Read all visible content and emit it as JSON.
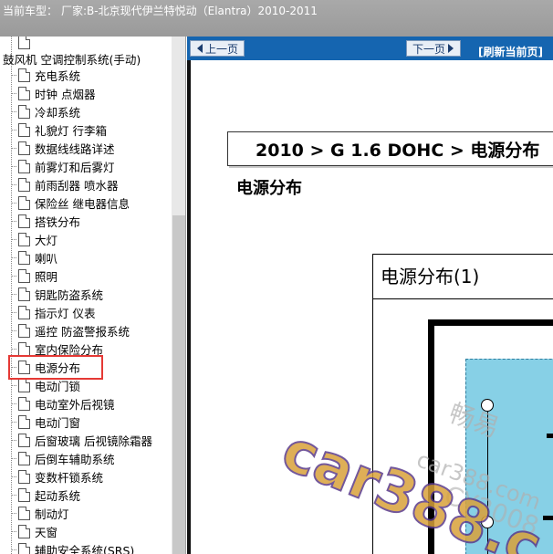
{
  "header": {
    "label": "当前车型：",
    "vehicle": "厂家:B-北京现代伊兰特悦动（Elantra）2010-2011"
  },
  "sidebar": {
    "folder_label": "鼓风机 空调控制系统(手动)",
    "items": [
      {
        "label": "充电系统"
      },
      {
        "label": "时钟 点烟器"
      },
      {
        "label": "冷却系统"
      },
      {
        "label": "礼貌灯 行李箱"
      },
      {
        "label": "数据线线路详述"
      },
      {
        "label": "前雾灯和后雾灯"
      },
      {
        "label": "前雨刮器 喷水器"
      },
      {
        "label": "保险丝 继电器信息"
      },
      {
        "label": "搭铁分布"
      },
      {
        "label": "大灯"
      },
      {
        "label": "喇叭"
      },
      {
        "label": "照明"
      },
      {
        "label": "钥匙防盗系统"
      },
      {
        "label": "指示灯 仪表"
      },
      {
        "label": "遥控 防盗警报系统"
      },
      {
        "label": "室内保险分布"
      },
      {
        "label": "电源分布"
      },
      {
        "label": "电动门锁"
      },
      {
        "label": "电动室外后视镜"
      },
      {
        "label": "电动门窗"
      },
      {
        "label": "后窗玻璃 后视镜除霜器"
      },
      {
        "label": "后倒车辅助系统"
      },
      {
        "label": "变数杆锁系统"
      },
      {
        "label": "起动系统"
      },
      {
        "label": "制动灯"
      },
      {
        "label": "天窗"
      },
      {
        "label": "辅助安全系统(SRS)"
      }
    ],
    "selected_index": 16
  },
  "nav": {
    "prev_label": "上一页",
    "next_label": "下一页",
    "refresh_label": "[刷新当前页]"
  },
  "content": {
    "breadcrumb": "2010 > G 1.6 DOHC > 电源分布",
    "title": "电源分布",
    "diagram_title": "电源分布(1)"
  },
  "watermark": {
    "text_main": "car388.c",
    "text_small": "car388.com",
    "text_cn": "畅易",
    "text_cy": "CY2008"
  },
  "colors": {
    "topbar": "#9e9e9e",
    "navbar": "#1565b0",
    "highlight": "#e53935",
    "diagram_fill": "#87d0e6"
  }
}
